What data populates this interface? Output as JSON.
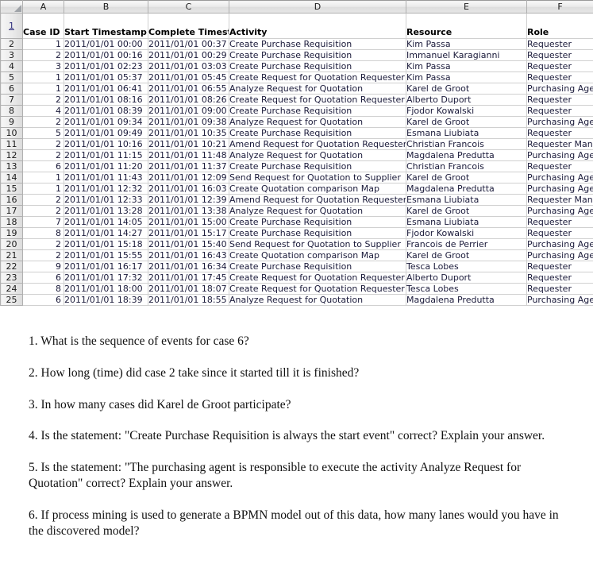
{
  "spreadsheet": {
    "corner_icon": "select-all-triangle-icon",
    "column_letters": [
      "A",
      "B",
      "C",
      "D",
      "E",
      "F"
    ],
    "header_row_number": "1",
    "headers": {
      "a": "Case ID",
      "b": "Start\nTimestamp",
      "c": "Complete\nTimestamp",
      "d": "Activity",
      "e": "Resource",
      "f": "Role"
    },
    "rows": [
      {
        "n": "2",
        "case_id": "1",
        "start": "2011/01/01 00:00",
        "complete": "2011/01/01 00:37",
        "activity": "Create Purchase Requisition",
        "resource": "Kim Passa",
        "role": "Requester"
      },
      {
        "n": "3",
        "case_id": "2",
        "start": "2011/01/01 00:16",
        "complete": "2011/01/01 00:29",
        "activity": "Create Purchase Requisition",
        "resource": "Immanuel Karagianni",
        "role": "Requester"
      },
      {
        "n": "4",
        "case_id": "3",
        "start": "2011/01/01 02:23",
        "complete": "2011/01/01 03:03",
        "activity": "Create Purchase Requisition",
        "resource": "Kim Passa",
        "role": "Requester"
      },
      {
        "n": "5",
        "case_id": "1",
        "start": "2011/01/01 05:37",
        "complete": "2011/01/01 05:45",
        "activity": "Create Request for Quotation Requester",
        "resource": "Kim Passa",
        "role": "Requester"
      },
      {
        "n": "6",
        "case_id": "1",
        "start": "2011/01/01 06:41",
        "complete": "2011/01/01 06:55",
        "activity": "Analyze Request for Quotation",
        "resource": "Karel de Groot",
        "role": "Purchasing Agent"
      },
      {
        "n": "7",
        "case_id": "2",
        "start": "2011/01/01 08:16",
        "complete": "2011/01/01 08:26",
        "activity": "Create Request for Quotation Requester",
        "resource": "Alberto Duport",
        "role": "Requester"
      },
      {
        "n": "8",
        "case_id": "4",
        "start": "2011/01/01 08:39",
        "complete": "2011/01/01 09:00",
        "activity": "Create Purchase Requisition",
        "resource": "Fjodor Kowalski",
        "role": "Requester"
      },
      {
        "n": "9",
        "case_id": "2",
        "start": "2011/01/01 09:34",
        "complete": "2011/01/01 09:38",
        "activity": "Analyze Request for Quotation",
        "resource": "Karel de Groot",
        "role": "Purchasing Agent"
      },
      {
        "n": "10",
        "case_id": "5",
        "start": "2011/01/01 09:49",
        "complete": "2011/01/01 10:35",
        "activity": "Create Purchase Requisition",
        "resource": "Esmana Liubiata",
        "role": "Requester"
      },
      {
        "n": "11",
        "case_id": "2",
        "start": "2011/01/01 10:16",
        "complete": "2011/01/01 10:21",
        "activity": "Amend Request for Quotation Requester",
        "resource": "Christian Francois",
        "role": "Requester Manager"
      },
      {
        "n": "12",
        "case_id": "2",
        "start": "2011/01/01 11:15",
        "complete": "2011/01/01 11:48",
        "activity": "Analyze Request for Quotation",
        "resource": "Magdalena Predutta",
        "role": "Purchasing Agent"
      },
      {
        "n": "13",
        "case_id": "6",
        "start": "2011/01/01 11:20",
        "complete": "2011/01/01 11:37",
        "activity": "Create Purchase Requisition",
        "resource": "Christian Francois",
        "role": "Requester"
      },
      {
        "n": "14",
        "case_id": "1",
        "start": "2011/01/01 11:43",
        "complete": "2011/01/01 12:09",
        "activity": "Send Request for Quotation to Supplier",
        "resource": "Karel de Groot",
        "role": "Purchasing Agent"
      },
      {
        "n": "15",
        "case_id": "1",
        "start": "2011/01/01 12:32",
        "complete": "2011/01/01 16:03",
        "activity": "Create Quotation comparison Map",
        "resource": "Magdalena Predutta",
        "role": "Purchasing Agent"
      },
      {
        "n": "16",
        "case_id": "2",
        "start": "2011/01/01 12:33",
        "complete": "2011/01/01 12:39",
        "activity": "Amend Request for Quotation Requester",
        "resource": "Esmana Liubiata",
        "role": "Requester Manager"
      },
      {
        "n": "17",
        "case_id": "2",
        "start": "2011/01/01 13:28",
        "complete": "2011/01/01 13:38",
        "activity": "Analyze Request for Quotation",
        "resource": "Karel de Groot",
        "role": "Purchasing Agent"
      },
      {
        "n": "18",
        "case_id": "7",
        "start": "2011/01/01 14:05",
        "complete": "2011/01/01 15:00",
        "activity": "Create Purchase Requisition",
        "resource": "Esmana Liubiata",
        "role": "Requester"
      },
      {
        "n": "19",
        "case_id": "8",
        "start": "2011/01/01 14:27",
        "complete": "2011/01/01 15:17",
        "activity": "Create Purchase Requisition",
        "resource": "Fjodor Kowalski",
        "role": "Requester"
      },
      {
        "n": "20",
        "case_id": "2",
        "start": "2011/01/01 15:18",
        "complete": "2011/01/01 15:40",
        "activity": "Send Request for Quotation to Supplier",
        "resource": "Francois de Perrier",
        "role": "Purchasing Agent"
      },
      {
        "n": "21",
        "case_id": "2",
        "start": "2011/01/01 15:55",
        "complete": "2011/01/01 16:43",
        "activity": "Create Quotation comparison Map",
        "resource": "Karel de Groot",
        "role": "Purchasing Agent"
      },
      {
        "n": "22",
        "case_id": "9",
        "start": "2011/01/01 16:17",
        "complete": "2011/01/01 16:34",
        "activity": "Create Purchase Requisition",
        "resource": "Tesca Lobes",
        "role": "Requester"
      },
      {
        "n": "23",
        "case_id": "6",
        "start": "2011/01/01 17:32",
        "complete": "2011/01/01 17:45",
        "activity": "Create Request for Quotation Requester",
        "resource": "Alberto Duport",
        "role": "Requester"
      },
      {
        "n": "24",
        "case_id": "8",
        "start": "2011/01/01 18:00",
        "complete": "2011/01/01 18:07",
        "activity": "Create Request for Quotation Requester",
        "resource": "Tesca Lobes",
        "role": "Requester"
      },
      {
        "n": "25",
        "case_id": "6",
        "start": "2011/01/01 18:39",
        "complete": "2011/01/01 18:55",
        "activity": "Analyze Request for Quotation",
        "resource": "Magdalena Predutta",
        "role": "Purchasing Agent"
      }
    ]
  },
  "questions": [
    "1. What is the sequence of events for case 6?",
    "2. How long (time) did case 2 take since it started till it is finished?",
    "3. In how many cases did Karel de Groot participate?",
    "4. Is the statement: \"Create Purchase Requisition is always the start event\" correct? Explain your answer.",
    "5. Is the statement: \"The purchasing agent is responsible to execute the activity Analyze Request for Quotation\" correct? Explain your answer.",
    "6. If process mining is used to generate a BPMN model out of this data, how many lanes would you have in the discovered model?"
  ]
}
